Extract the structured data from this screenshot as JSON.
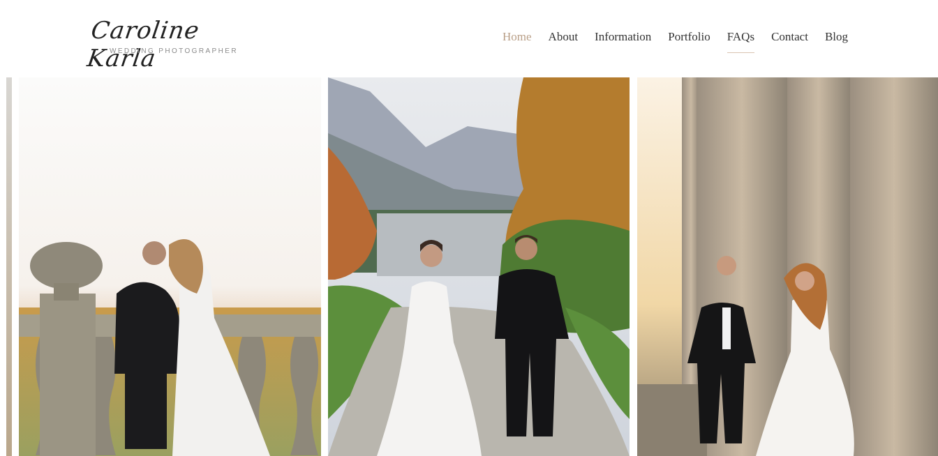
{
  "brand": {
    "name": "Caroline Karla",
    "tagline": "WEDDING PHOTOGRAPHER"
  },
  "nav": {
    "items": [
      {
        "label": "Home",
        "active": true
      },
      {
        "label": "About",
        "active": false
      },
      {
        "label": "Information",
        "active": false
      },
      {
        "label": "Portfolio",
        "active": false
      },
      {
        "label": "FAQs",
        "active": false,
        "underlined": true
      },
      {
        "label": "Contact",
        "active": false
      },
      {
        "label": "Blog",
        "active": false
      }
    ]
  },
  "gallery": {
    "photos": [
      {
        "alt": "partial-edge-photo"
      },
      {
        "alt": "couple-at-balustrade"
      },
      {
        "alt": "couple-walking-lake-path"
      },
      {
        "alt": "couple-by-columns"
      }
    ]
  },
  "colors": {
    "accent": "#b99f87",
    "text": "#333333",
    "background": "#ffffff"
  }
}
